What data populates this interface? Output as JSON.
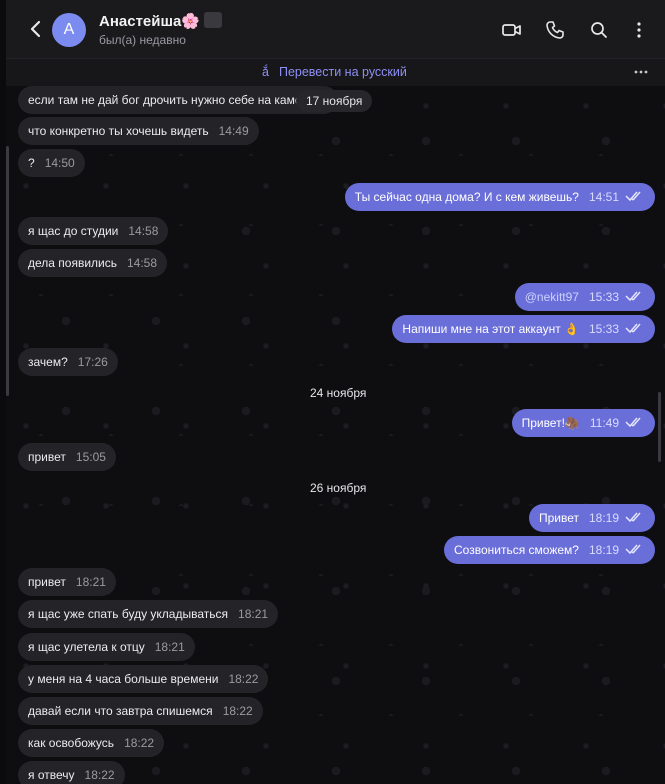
{
  "header": {
    "back_icon": "back-arrow-icon",
    "avatar_letter": "А",
    "name": "Анастейша",
    "name_emoji": "🌸",
    "status": "был(а) недавно",
    "icons": [
      "video-call-icon",
      "phone-icon",
      "search-icon",
      "more-vertical-icon"
    ]
  },
  "translate_bar": {
    "label": "Перевести на русский",
    "icon": "translate-icon"
  },
  "colors": {
    "accent": "#6a6ed8",
    "link": "#8e8ff4",
    "incoming": "#242428",
    "header": "#1a1a1d"
  },
  "messages": [
    {
      "text": "если там не дай бог дрочить нужно себе на каме",
      "time": "",
      "dir": "in"
    },
    {
      "text": "что конкретно ты хочешь видеть",
      "time": "14:49",
      "dir": "in"
    },
    {
      "text": "?",
      "time": "14:50",
      "dir": "in"
    },
    {
      "text": "Ты сейчас одна дома? И с кем живешь?",
      "time": "14:51",
      "dir": "out"
    },
    {
      "text": "я щас до студии",
      "time": "14:58",
      "dir": "in"
    },
    {
      "text": "дела появились",
      "time": "14:58",
      "dir": "in"
    },
    {
      "text": "@nekitt97",
      "time": "15:33",
      "dir": "out"
    },
    {
      "text": "Напиши мне на этот аккаунт 👌",
      "time": "15:33",
      "dir": "out"
    },
    {
      "text": "зачем?",
      "time": "17:26",
      "dir": "in"
    },
    {
      "text": "Привет!🦣",
      "time": "11:49",
      "dir": "out"
    },
    {
      "text": "привет",
      "time": "15:05",
      "dir": "in"
    },
    {
      "text": "Привет",
      "time": "18:19",
      "dir": "out"
    },
    {
      "text": "Созвониться сможем?",
      "time": "18:19",
      "dir": "out"
    },
    {
      "text": "привет",
      "time": "18:21",
      "dir": "in"
    },
    {
      "text": "я щас уже спать буду укладываться",
      "time": "18:21",
      "dir": "in"
    },
    {
      "text": "я щас улетела к отцу",
      "time": "18:21",
      "dir": "in"
    },
    {
      "text": "у меня на 4 часа больше времени",
      "time": "18:22",
      "dir": "in"
    },
    {
      "text": "давай если что завтра спишемся",
      "time": "18:22",
      "dir": "in"
    },
    {
      "text": "как освобожусь",
      "time": "18:22",
      "dir": "in"
    },
    {
      "text": "я отвечу",
      "time": "18:22",
      "dir": "in"
    }
  ],
  "dates": [
    "17 ноября",
    "24 ноября",
    "26 ноября"
  ]
}
